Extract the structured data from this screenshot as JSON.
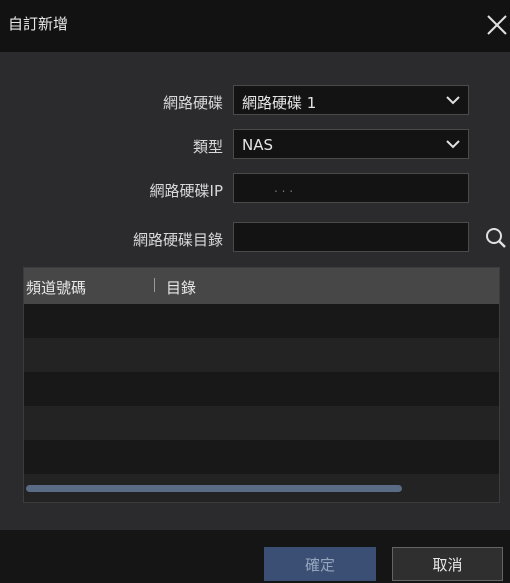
{
  "dialog": {
    "title": "自訂新增"
  },
  "form": {
    "nas_label": "網路硬碟",
    "nas_value": "網路硬碟 1",
    "type_label": "類型",
    "type_value": "NAS",
    "ip_label": "網路硬碟IP",
    "ip_value": ".   .   .",
    "dir_label": "網路硬碟目錄",
    "dir_value": ""
  },
  "table": {
    "columns": [
      "頻道號碼",
      "目錄"
    ],
    "rows": [],
    "empty_row_count": 6
  },
  "buttons": {
    "ok": "確定",
    "cancel": "取消"
  },
  "icons": [
    "close-icon",
    "chevron-down-icon",
    "search-icon"
  ],
  "colors": {
    "titlebar": "#121212",
    "background": "#2b2b2d",
    "primary_button": "#3a4f73",
    "scrollbar": "#5a6b85"
  }
}
